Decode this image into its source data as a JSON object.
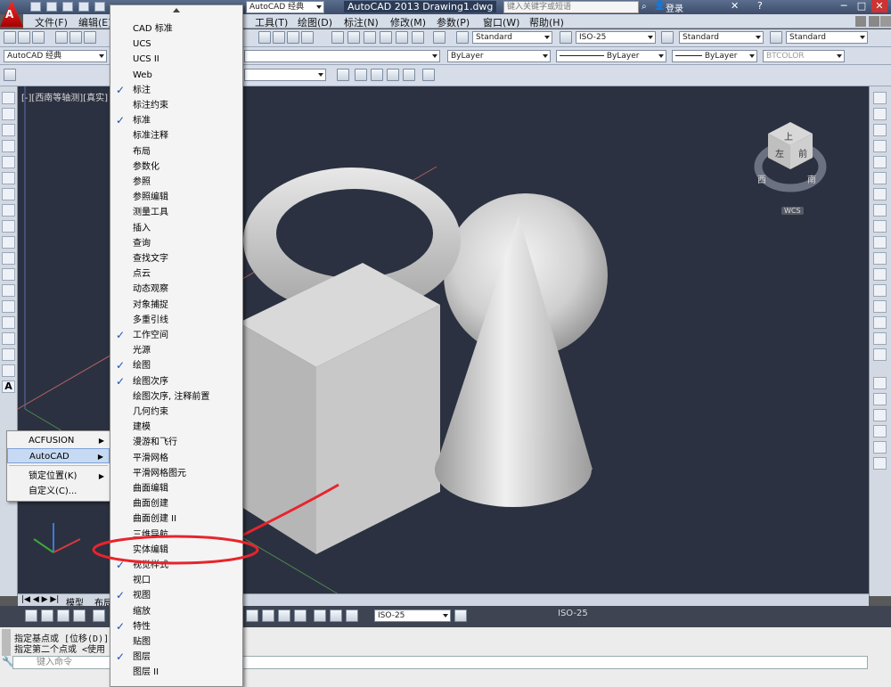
{
  "app": {
    "logo_text": "A",
    "title": "AutoCAD 2013    Drawing1.dwg",
    "search_placeholder": "键入关键字或短语",
    "login": "登录",
    "workspace_quick": "AutoCAD 经典"
  },
  "menubar": [
    "文件(F)",
    "编辑(E)",
    "工具(T)",
    "绘图(D)",
    "标注(N)",
    "修改(M)",
    "参数(P)",
    "窗口(W)",
    "帮助(H)"
  ],
  "styles_toolbar": {
    "text_style": "Standard",
    "dim_style": "ISO-25",
    "table_style": "Standard",
    "mleader_style": "Standard"
  },
  "workspace_combo": "AutoCAD 经典",
  "properties_toolbar": {
    "color": "ByLayer",
    "linetype": "ByLayer",
    "lineweight": "ByLayer",
    "plotstyle": "BTCOLOR"
  },
  "viewport": {
    "label": "[-][西南等轴测][真实]",
    "cube_labels": {
      "top": "上",
      "front": "前",
      "left": "左",
      "south": "南",
      "west": "西"
    },
    "wcs": "WCS",
    "bg_color": "#2b3140"
  },
  "tabs": {
    "model": "模型",
    "layout": "布局"
  },
  "status": {
    "dim_scale": "ISO-25",
    "dim_scale_2": "ISO-25"
  },
  "command": {
    "line1": "指定基点或 [位移(D)]",
    "line2": "指定第二个点或 <使用",
    "placeholder": "键入命令"
  },
  "context_menu": {
    "items": [
      {
        "label": "ACFUSION",
        "submenu": true
      },
      {
        "label": "AutoCAD",
        "submenu": true,
        "highlighted": true
      },
      {
        "label": "锁定位置(K)",
        "submenu": true
      },
      {
        "label": "自定义(C)...",
        "submenu": false
      }
    ]
  },
  "toolbar_menu": {
    "items": [
      {
        "label": "CAD 标准",
        "checked": false
      },
      {
        "label": "UCS",
        "checked": false
      },
      {
        "label": "UCS II",
        "checked": false
      },
      {
        "label": "Web",
        "checked": false
      },
      {
        "label": "标注",
        "checked": true
      },
      {
        "label": "标注约束",
        "checked": false
      },
      {
        "label": "标准",
        "checked": true
      },
      {
        "label": "标准注释",
        "checked": false
      },
      {
        "label": "布局",
        "checked": false
      },
      {
        "label": "参数化",
        "checked": false
      },
      {
        "label": "参照",
        "checked": false
      },
      {
        "label": "参照编辑",
        "checked": false
      },
      {
        "label": "测量工具",
        "checked": false
      },
      {
        "label": "插入",
        "checked": false
      },
      {
        "label": "查询",
        "checked": false
      },
      {
        "label": "查找文字",
        "checked": false
      },
      {
        "label": "点云",
        "checked": false
      },
      {
        "label": "动态观察",
        "checked": false
      },
      {
        "label": "对象捕捉",
        "checked": false
      },
      {
        "label": "多重引线",
        "checked": false
      },
      {
        "label": "工作空间",
        "checked": true
      },
      {
        "label": "光源",
        "checked": false
      },
      {
        "label": "绘图",
        "checked": true
      },
      {
        "label": "绘图次序",
        "checked": true
      },
      {
        "label": "绘图次序, 注释前置",
        "checked": false
      },
      {
        "label": "几何约束",
        "checked": false
      },
      {
        "label": "建模",
        "checked": false
      },
      {
        "label": "漫游和飞行",
        "checked": false
      },
      {
        "label": "平滑网格",
        "checked": false
      },
      {
        "label": "平滑网格图元",
        "checked": false
      },
      {
        "label": "曲面编辑",
        "checked": false
      },
      {
        "label": "曲面创建",
        "checked": false
      },
      {
        "label": "曲面创建 II",
        "checked": false
      },
      {
        "label": "三维导航",
        "checked": false
      },
      {
        "label": "实体编辑",
        "checked": false,
        "circled": true
      },
      {
        "label": "视觉样式",
        "checked": true
      },
      {
        "label": "视口",
        "checked": false
      },
      {
        "label": "视图",
        "checked": true
      },
      {
        "label": "缩放",
        "checked": false
      },
      {
        "label": "特性",
        "checked": true
      },
      {
        "label": "贴图",
        "checked": false
      },
      {
        "label": "图层",
        "checked": true
      },
      {
        "label": "图层 II",
        "checked": false
      }
    ]
  },
  "annotation": {
    "color": "#e8242c"
  }
}
